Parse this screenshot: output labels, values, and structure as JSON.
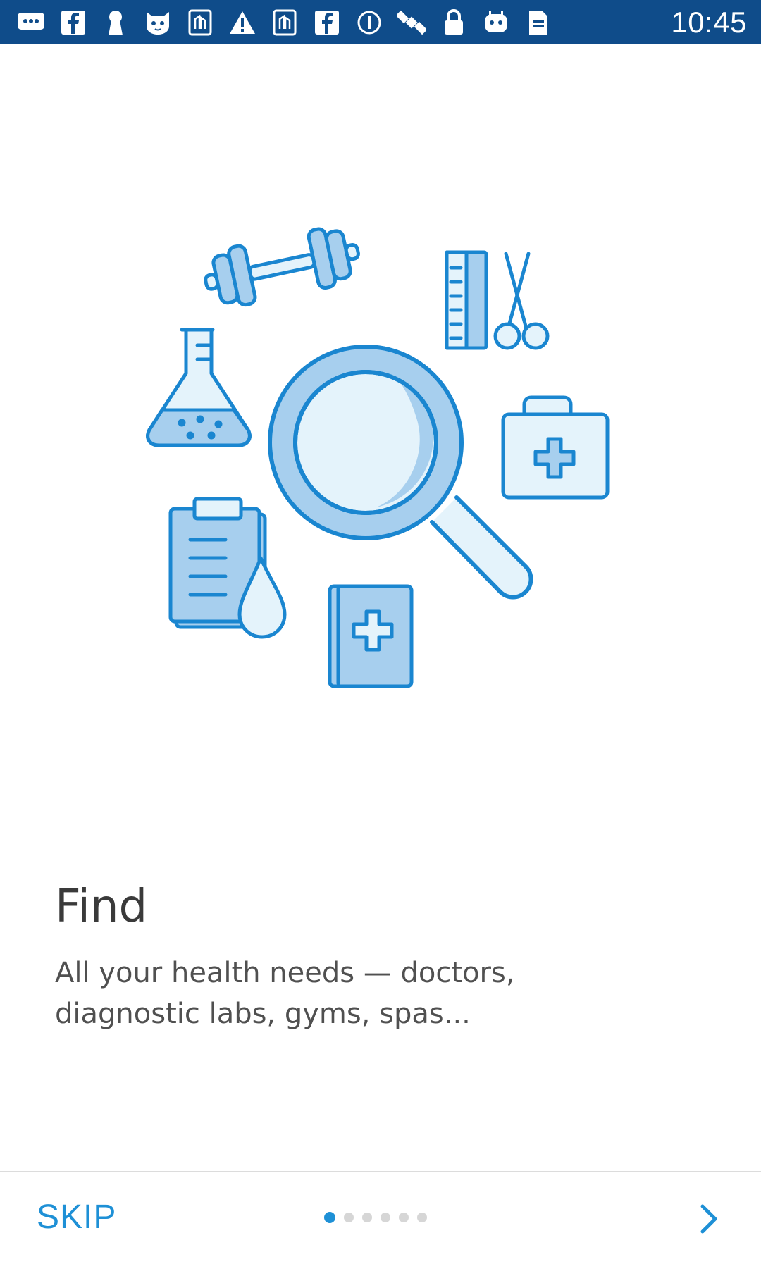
{
  "status_bar": {
    "time": "10:45",
    "icons": [
      "chat-icon",
      "facebook-icon",
      "keyhole-icon",
      "cat-icon",
      "app-icon",
      "warning-icon",
      "app-icon",
      "facebook-icon",
      "info-icon",
      "satellite-icon",
      "lock-icon",
      "android-icon",
      "document-icon"
    ]
  },
  "onboarding": {
    "title": "Find",
    "description": "All your health needs — doctors, diagnostic labs, gyms, spas...",
    "skip_label": "SKIP",
    "current_page": 1,
    "total_pages": 6
  },
  "colors": {
    "status_bar": "#0f4c8a",
    "accent": "#1e90d6",
    "illustration_stroke": "#1a86d0",
    "illustration_fill": "#a7cfee",
    "illustration_light": "#e4f3fb"
  }
}
